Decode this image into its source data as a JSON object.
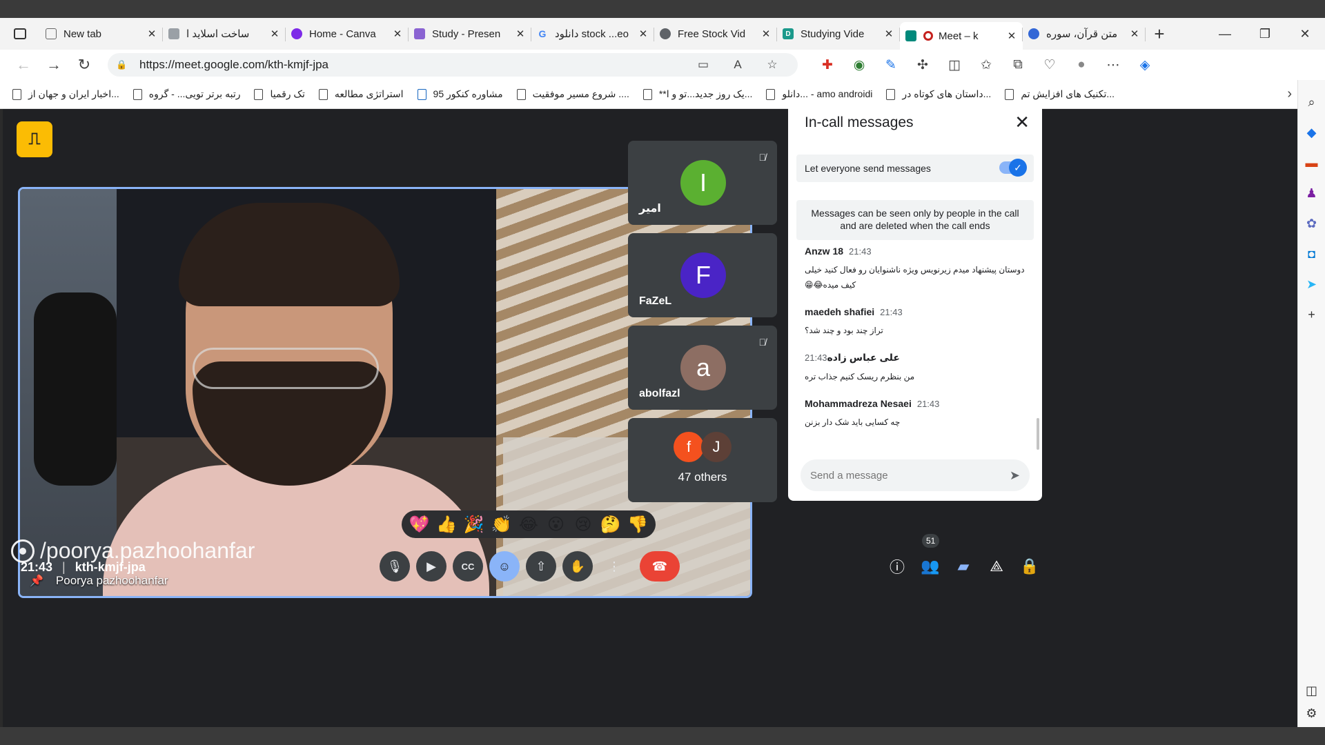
{
  "browser": {
    "tabs": [
      {
        "title": "New tab",
        "fav": "#888888"
      },
      {
        "title": "ساخت اسلاید ا",
        "fav": "#9aa0a6"
      },
      {
        "title": "Home - Canva",
        "fav": "#7d2ae8"
      },
      {
        "title": "Study - Presen",
        "fav": "#8a63d2"
      },
      {
        "title": "دانلود stock ...eo",
        "fav": "#4285f4"
      },
      {
        "title": "Free Stock Vid",
        "fav": "#5f6368"
      },
      {
        "title": "Studying Vide",
        "fav": "#1b998b"
      },
      {
        "title": "Meet – k",
        "fav": "#00897b"
      },
      {
        "title": "متن قرآن، سوره",
        "fav": "#3367d6"
      }
    ],
    "url": "https://meet.google.com/kth-kmjf-jpa",
    "bookmarks": [
      "اخبار ایران و جهان از...",
      "رتبه برتر تویی... - گروه",
      "تک رقمیا",
      "استراتژی مطالعه",
      "مشاوره کنکور 95",
      "شروع مسیر موفقیت ....",
      "**یک روز جدید...تو و ا...",
      "دانلو... - amo androidi",
      "داستان های کوتاه در...",
      "تکنیک های افزایش تم..."
    ]
  },
  "meet": {
    "main_speaker": "Poorya pazhoohanfar",
    "tiles": [
      {
        "initial": "I",
        "name": "امیر",
        "color": "#5bb031",
        "muted": true
      },
      {
        "initial": "F",
        "name": "FaZeL",
        "color": "#4a24c6",
        "muted": false
      },
      {
        "initial": "a",
        "name": "abolfazl",
        "color": "#8d6e63",
        "muted": true
      }
    ],
    "others": {
      "a": "f",
      "a_color": "#f4511e",
      "b": "J",
      "b_color": "#5d4037",
      "label": "47 others"
    },
    "watermark": "/poorya.pazhoohanfar",
    "time": "21:43",
    "meeting_code": "kth-kmjf-jpa",
    "reactions": [
      "💖",
      "👍",
      "🎉",
      "👏",
      "😂",
      "😮",
      "😢",
      "🤔",
      "👎"
    ],
    "participants_count": "51"
  },
  "chat": {
    "title": "In-call messages",
    "toggle_label": "Let everyone send messages",
    "notice": "Messages can be seen only by people in the call and are deleted when the call ends",
    "messages": [
      {
        "sender": "Anzw 18",
        "time": "21:43",
        "text": "دوستان پیشنهاد میدم زیرنویس ویژه ناشنوایان رو فعال کنید خیلی کیف میده😂😁"
      },
      {
        "sender": "maedeh shafiei",
        "time": "21:43",
        "text": "تراز چند بود و چند شد؟"
      },
      {
        "sender": "علی عباس زاده",
        "time": "21:43",
        "text": "من بنظرم ریسک کنیم جذاب تره"
      },
      {
        "sender": "Mohammadreza Nesaei",
        "time": "21:43",
        "text": "چه کسایی باید شک دار بزنن"
      }
    ],
    "placeholder": "Send a message"
  }
}
